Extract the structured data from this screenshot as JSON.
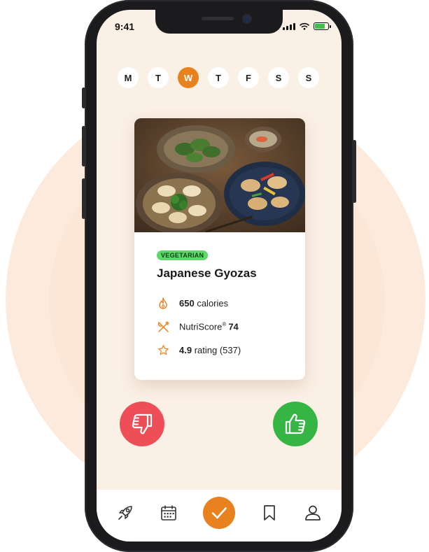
{
  "status_bar": {
    "time": "9:41"
  },
  "week": {
    "days": [
      "M",
      "T",
      "W",
      "T",
      "F",
      "S",
      "S"
    ],
    "active_index": 2
  },
  "recipe": {
    "badge": "VEGETARIAN",
    "title": "Japanese Gyozas",
    "calories_value": "650",
    "calories_label": "calories",
    "nutriscore_label": "NutriScore",
    "nutriscore_mark": "®",
    "nutriscore_value": "74",
    "rating_value": "4.9",
    "rating_label": "rating (537)"
  },
  "actions": {
    "dislike_icon": "thumbs-down-icon",
    "like_icon": "thumbs-up-icon"
  },
  "nav": {
    "items": [
      "rocket-icon",
      "calendar-icon",
      "check-icon",
      "bookmark-icon",
      "user-icon"
    ]
  },
  "colors": {
    "accent": "#e8821f",
    "background": "#fbf0e6",
    "badge_green": "#5ed86a",
    "like_green": "#35b544",
    "dislike_red": "#ee4e57"
  }
}
